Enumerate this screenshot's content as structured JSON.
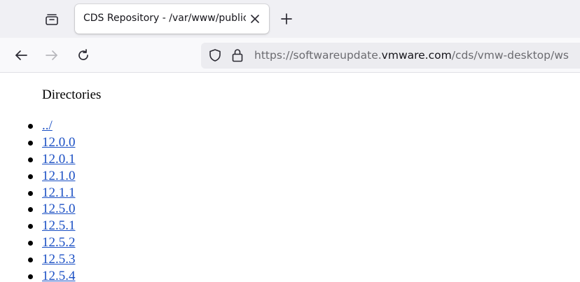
{
  "tab": {
    "title": "CDS Repository - /var/www/public/"
  },
  "urlbar": {
    "prefix": "https://softwareupdate.",
    "domain": "vmware.com",
    "path": "/cds/vmw-desktop/ws"
  },
  "page": {
    "heading": "Directories",
    "links": [
      "../",
      "12.0.0",
      "12.0.1",
      "12.1.0",
      "12.1.1",
      "12.5.0",
      "12.5.1",
      "12.5.2",
      "12.5.3",
      "12.5.4"
    ]
  },
  "icons": {
    "tab_list": "tab-list-icon",
    "close": "close-icon",
    "new_tab": "plus-icon",
    "back": "back-arrow-icon",
    "forward": "forward-arrow-icon",
    "reload": "reload-icon",
    "tracking": "shield-icon",
    "security": "lock-icon"
  }
}
